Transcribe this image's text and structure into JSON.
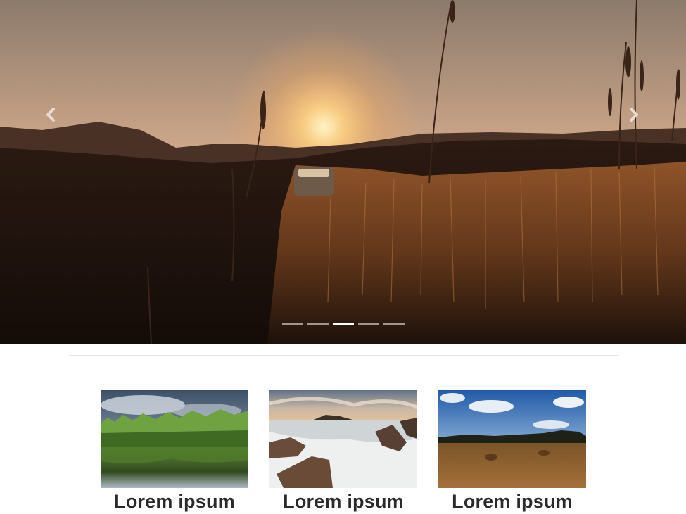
{
  "carousel": {
    "slides_count": 5,
    "active_index": 2,
    "prev_icon": "chevron-left-icon",
    "next_icon": "chevron-right-icon"
  },
  "gallery": {
    "cards": [
      {
        "title": "Lorem ipsum",
        "image": "forest-lake"
      },
      {
        "title": "Lorem ipsum",
        "image": "rocky-seashore"
      },
      {
        "title": "Lorem ipsum",
        "image": "golden-field"
      }
    ]
  },
  "colors": {
    "indicator_active": "#ffffff",
    "indicator_inactive": "#8c8c8c",
    "title_text": "#2a2a2a",
    "divider": "#e4e4e4"
  }
}
